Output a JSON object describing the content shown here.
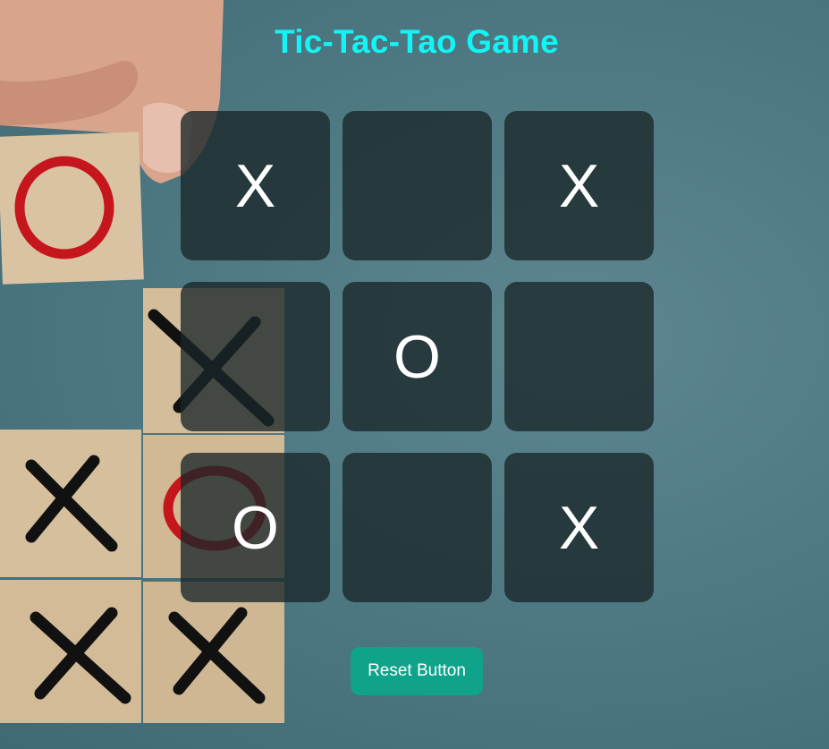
{
  "title": "Tic-Tac-Tao Game",
  "board": {
    "cells": [
      "X",
      "",
      "X",
      "",
      "O",
      "",
      "O",
      "",
      "X"
    ]
  },
  "reset_label": "Reset Button",
  "colors": {
    "title": "#12f4f6",
    "cell_bg": "#1c2b2e",
    "mark": "#ffffff",
    "reset_button": "#0fa38b"
  }
}
